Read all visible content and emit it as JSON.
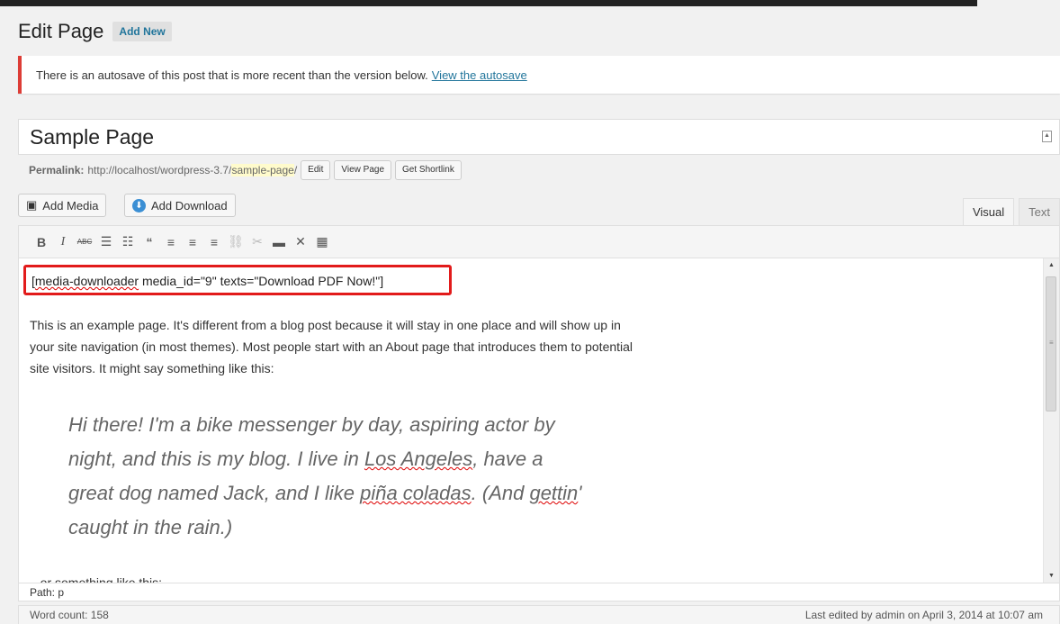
{
  "header": {
    "title": "Edit Page",
    "add_new": "Add New"
  },
  "notice": {
    "text": "There is an autosave of this post that is more recent than the version below.",
    "link": "View the autosave"
  },
  "post": {
    "title": "Sample Page",
    "permalink_label": "Permalink:",
    "permalink_base": "http://localhost/wordpress-3.7/",
    "permalink_slug": "sample-page",
    "permalink_end": "/",
    "buttons": {
      "edit": "Edit",
      "view": "View Page",
      "shortlink": "Get Shortlink"
    }
  },
  "media": {
    "add_media": "Add Media",
    "add_download": "Add Download"
  },
  "tabs": {
    "visual": "Visual",
    "text": "Text"
  },
  "toolbar_icons": [
    "bold-icon",
    "italic-icon",
    "strikethrough-icon",
    "bullet-list-icon",
    "numbered-list-icon",
    "blockquote-icon",
    "align-left-icon",
    "align-center-icon",
    "align-right-icon",
    "link-icon",
    "unlink-icon",
    "read-more-icon",
    "fullscreen-icon",
    "kitchen-sink-icon"
  ],
  "editor": {
    "shortcode_open": "[",
    "shortcode_tag": "media-downloader",
    "shortcode_rest": " media_id=\"9\" texts=\"Download PDF Now!\"]",
    "paragraph": "This is an example page. It's different from a blog post because it will stay in one place and will show up in your site navigation (in most themes). Most people start with an About page that introduces them to potential site visitors. It might say something like this:",
    "quote_a": "Hi there! I'm a bike messenger by day, aspiring actor by night, and this is my blog. I live in ",
    "quote_city": "Los Angeles",
    "quote_b": ", have a great dog named Jack, and I like ",
    "quote_drink": "piña coladas",
    "quote_c": ". (And ",
    "quote_gettin": "gettin",
    "quote_d": "' caught in the rain.)",
    "more": "...or something like this:"
  },
  "path": "Path: p",
  "status": {
    "word_count": "Word count: 158",
    "last_edited": "Last edited by admin on April 3, 2014 at 10:07 am"
  },
  "colors": {
    "notice_border": "#dd3d36",
    "highlight_box": "#e21b1b",
    "link": "#21759b"
  }
}
